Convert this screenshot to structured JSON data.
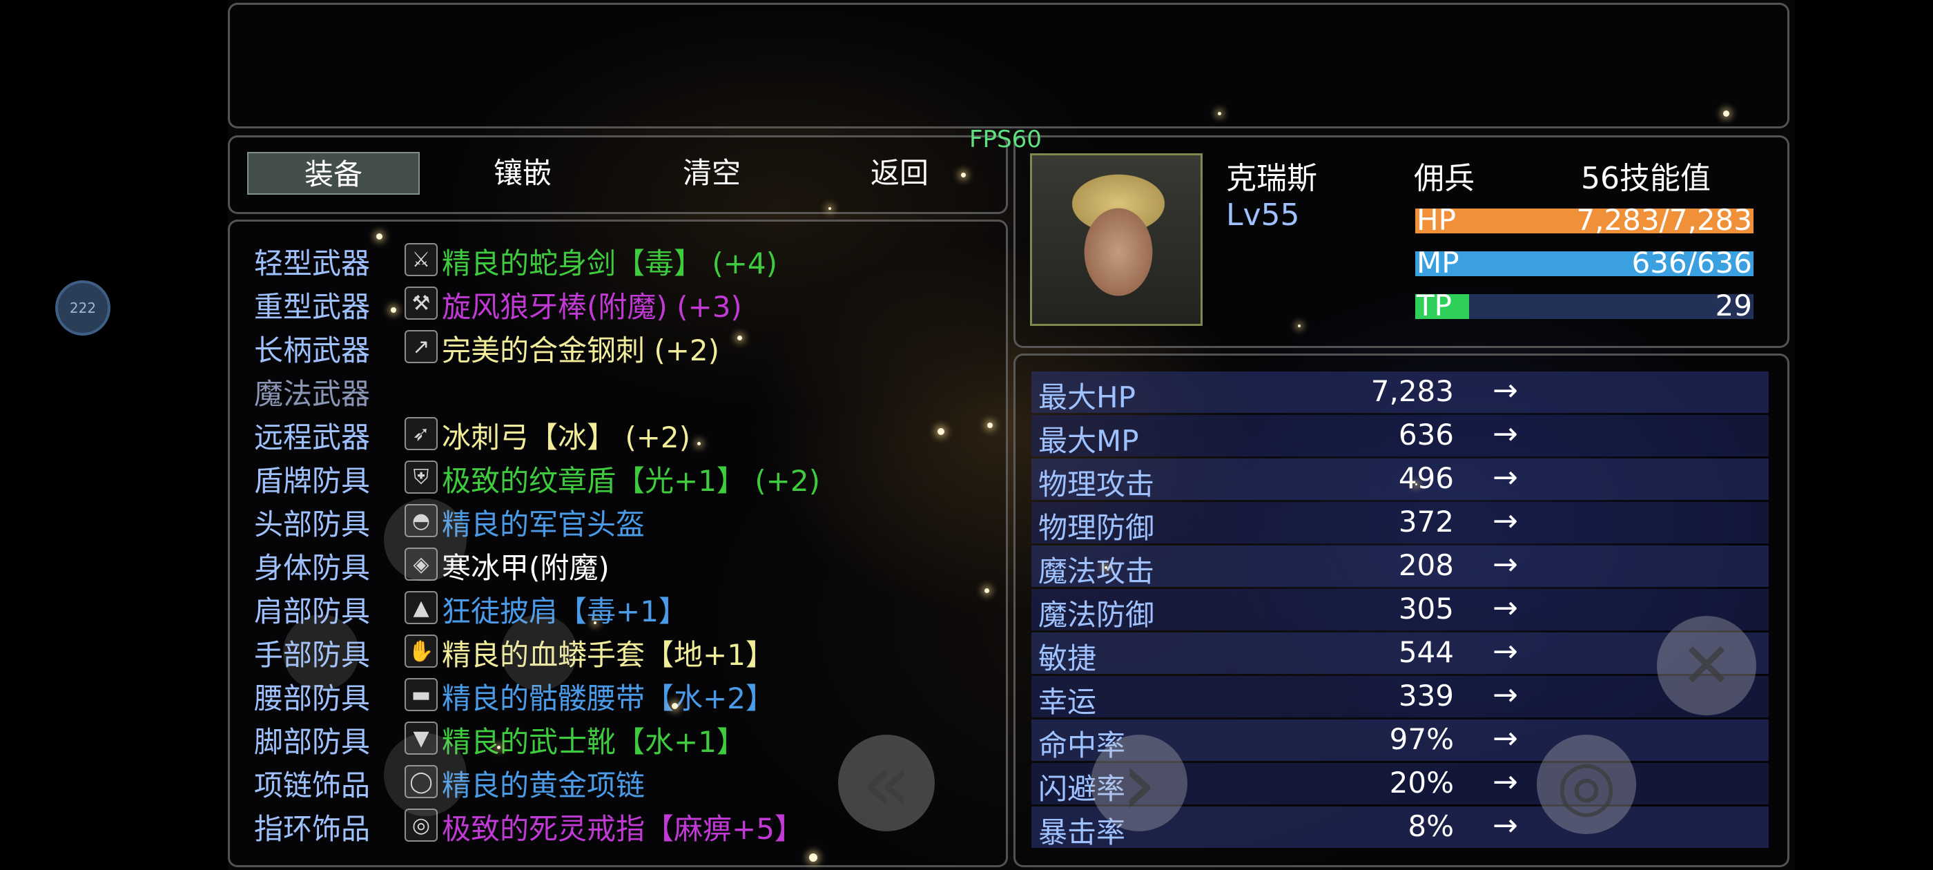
{
  "fps": "FPS60",
  "badge": "222",
  "tabs": [
    "装备",
    "镶嵌",
    "清空",
    "返回"
  ],
  "equipment": [
    {
      "slot": "轻型武器",
      "item": "精良的蛇身剑【毒】 (+4)",
      "color": "#3ecb3e",
      "icon": "sword-icon"
    },
    {
      "slot": "重型武器",
      "item": "旋风狼牙棒(附魔) (+3)",
      "color": "#c23ad6",
      "icon": "mace-icon"
    },
    {
      "slot": "长柄武器",
      "item": "完美的合金钢刺 (+2)",
      "color": "#f2ed9b",
      "icon": "spear-icon"
    },
    {
      "slot": "魔法武器",
      "item": "",
      "color": "#8a96b3",
      "icon": ""
    },
    {
      "slot": "远程武器",
      "item": "冰刺弓【冰】 (+2)",
      "color": "#f2ed9b",
      "icon": "bow-icon"
    },
    {
      "slot": "盾牌防具",
      "item": "极致的纹章盾【光+1】 (+2)",
      "color": "#3ecb3e",
      "icon": "shield-icon"
    },
    {
      "slot": "头部防具",
      "item": "精良的军官头盔",
      "color": "#4a9be8",
      "icon": "helmet-icon"
    },
    {
      "slot": "身体防具",
      "item": "寒冰甲(附魔)",
      "color": "#ffffff",
      "icon": "armor-icon"
    },
    {
      "slot": "肩部防具",
      "item": "狂徒披肩【毒+1】",
      "color": "#4a9be8",
      "icon": "shoulder-icon"
    },
    {
      "slot": "手部防具",
      "item": "精良的血蟒手套【地+1】",
      "color": "#f2ed9b",
      "icon": "gloves-icon"
    },
    {
      "slot": "腰部防具",
      "item": "精良的骷髅腰带【水+2】",
      "color": "#4a9be8",
      "icon": "belt-icon"
    },
    {
      "slot": "脚部防具",
      "item": "精良的武士靴【水+1】",
      "color": "#3ecb3e",
      "icon": "boots-icon"
    },
    {
      "slot": "项链饰品",
      "item": "精良的黄金项链",
      "color": "#4a9be8",
      "icon": "necklace-icon"
    },
    {
      "slot": "指环饰品",
      "item": "极致的死灵戒指【麻痹+5】",
      "color": "#c23ad6",
      "icon": "ring-icon"
    }
  ],
  "character": {
    "name": "克瑞斯",
    "class": "佣兵",
    "skill_points": "56技能值",
    "level": "Lv55",
    "hp": {
      "label": "HP",
      "value": "7,283/7,283",
      "fraction": 1.0,
      "color": "#f0913a"
    },
    "mp": {
      "label": "MP",
      "value": "636/636",
      "fraction": 1.0,
      "color": "#3aa0e0"
    },
    "tp": {
      "label": "TP",
      "value": "29",
      "fraction": 0.16,
      "color": "#2fd05a"
    }
  },
  "stats": [
    {
      "name": "最大HP",
      "value": "7,283"
    },
    {
      "name": "最大MP",
      "value": "636"
    },
    {
      "name": "物理攻击",
      "value": "496"
    },
    {
      "name": "物理防御",
      "value": "372"
    },
    {
      "name": "魔法攻击",
      "value": "208"
    },
    {
      "name": "魔法防御",
      "value": "305"
    },
    {
      "name": "敏捷",
      "value": "544"
    },
    {
      "name": "幸运",
      "value": "339"
    },
    {
      "name": "命中率",
      "value": "97%"
    },
    {
      "name": "闪避率",
      "value": "20%"
    },
    {
      "name": "暴击率",
      "value": "8%"
    }
  ],
  "arrow": "→",
  "controls": {
    "back": "«",
    "forward": "›",
    "close": "✕",
    "confirm": "◎"
  }
}
